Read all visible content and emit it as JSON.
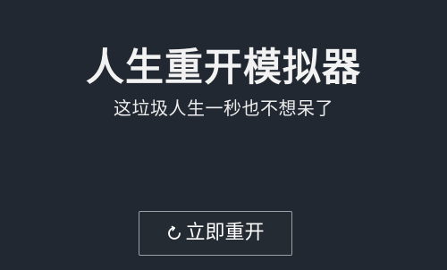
{
  "colors": {
    "background": "#222831",
    "text": "#f2f2f2",
    "button_border": "#9aa0a6"
  },
  "header": {
    "title": "人生重开模拟器",
    "subtitle": "这垃圾人生一秒也不想呆了"
  },
  "main": {
    "restart_button": {
      "icon": "refresh-icon",
      "label": "立即重开"
    }
  }
}
